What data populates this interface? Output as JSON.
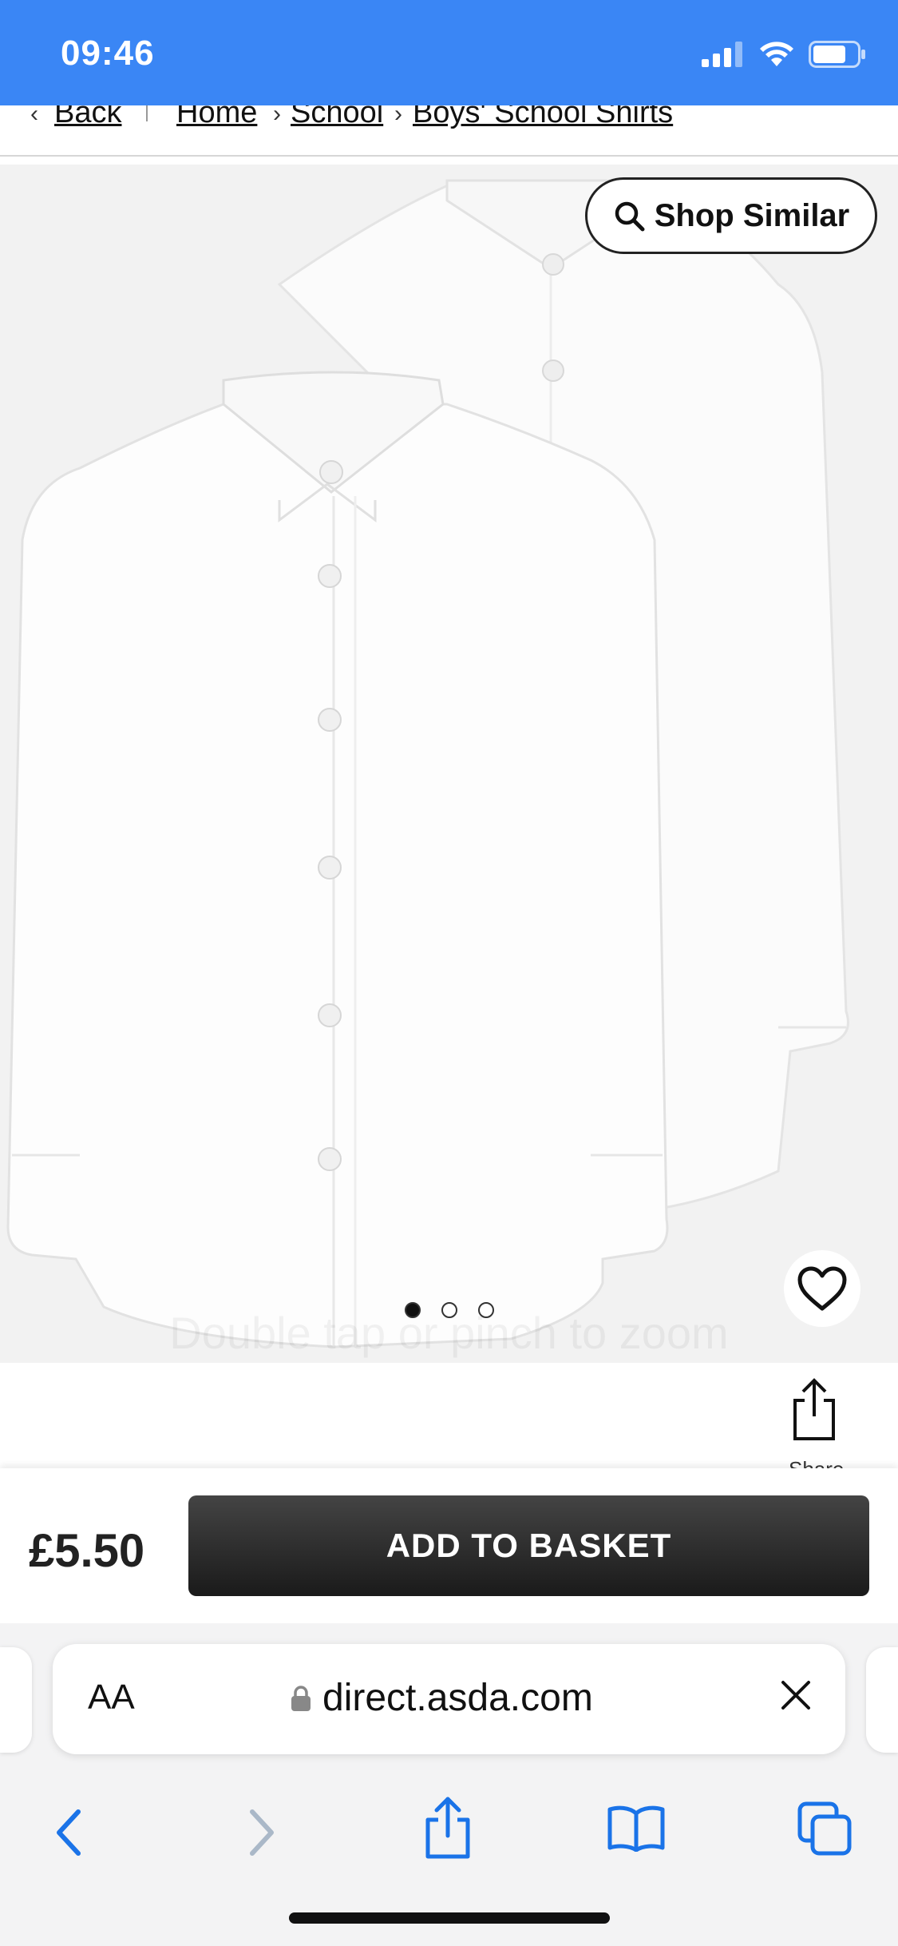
{
  "status_bar": {
    "time": "09:46"
  },
  "breadcrumb": {
    "back_label": "Back",
    "items": [
      "Home",
      "School",
      "Boys' School Shirts"
    ]
  },
  "gallery": {
    "shop_similar_label": "Shop Similar",
    "zoom_hint": "Double tap or pinch to zoom",
    "current_slide": 1,
    "total_slides": 3
  },
  "share": {
    "label": "Share"
  },
  "buy_bar": {
    "price": "£5.50",
    "add_to_basket_label": "ADD TO BASKET"
  },
  "browser": {
    "aa_label": "AA",
    "url": "direct.asda.com"
  },
  "colors": {
    "status_bar": "#3a86f5",
    "safari_blue": "#1a73e8",
    "button_dark": "#222222"
  }
}
